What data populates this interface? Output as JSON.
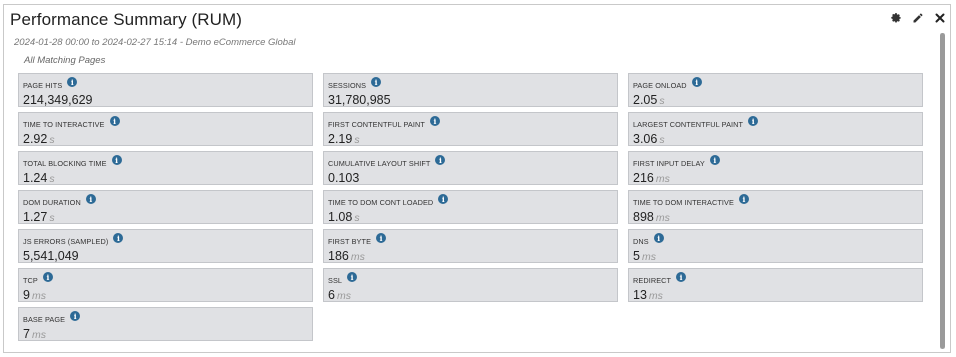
{
  "header": {
    "title": "Performance Summary (RUM)",
    "subtitle": "2024-01-28 00:00 to 2024-02-27 15:14 - Demo eCommerce Global",
    "scope": "All Matching Pages",
    "icons": [
      "gear-icon",
      "pencil-icon",
      "close-icon"
    ]
  },
  "tiles": [
    {
      "label": "PAGE HITS",
      "value": "214,349,629",
      "unit": ""
    },
    {
      "label": "SESSIONS",
      "value": "31,780,985",
      "unit": ""
    },
    {
      "label": "PAGE ONLOAD",
      "value": "2.05",
      "unit": "s"
    },
    {
      "label": "TIME TO INTERACTIVE",
      "value": "2.92",
      "unit": "s"
    },
    {
      "label": "FIRST CONTENTFUL PAINT",
      "value": "2.19",
      "unit": "s"
    },
    {
      "label": "LARGEST CONTENTFUL PAINT",
      "value": "3.06",
      "unit": "s"
    },
    {
      "label": "TOTAL BLOCKING TIME",
      "value": "1.24",
      "unit": "s"
    },
    {
      "label": "CUMULATIVE LAYOUT SHIFT",
      "value": "0.103",
      "unit": ""
    },
    {
      "label": "FIRST INPUT DELAY",
      "value": "216",
      "unit": "ms"
    },
    {
      "label": "DOM DURATION",
      "value": "1.27",
      "unit": "s"
    },
    {
      "label": "TIME TO DOM CONT LOADED",
      "value": "1.08",
      "unit": "s"
    },
    {
      "label": "TIME TO DOM INTERACTIVE",
      "value": "898",
      "unit": "ms"
    },
    {
      "label": "JS ERRORS (SAMPLED)",
      "value": "5,541,049",
      "unit": ""
    },
    {
      "label": "FIRST BYTE",
      "value": "186",
      "unit": "ms"
    },
    {
      "label": "DNS",
      "value": "5",
      "unit": "ms"
    },
    {
      "label": "TCP",
      "value": "9",
      "unit": "ms"
    },
    {
      "label": "SSL",
      "value": "6",
      "unit": "ms"
    },
    {
      "label": "REDIRECT",
      "value": "13",
      "unit": "ms"
    },
    {
      "label": "BASE PAGE",
      "value": "7",
      "unit": "ms"
    }
  ],
  "info_glyph": "i",
  "colors": {
    "tile_bg": "#e0e1e4",
    "tile_border": "#c4c6ca",
    "info_icon": "#2d6a96",
    "unit_text": "#9a9a9a"
  }
}
